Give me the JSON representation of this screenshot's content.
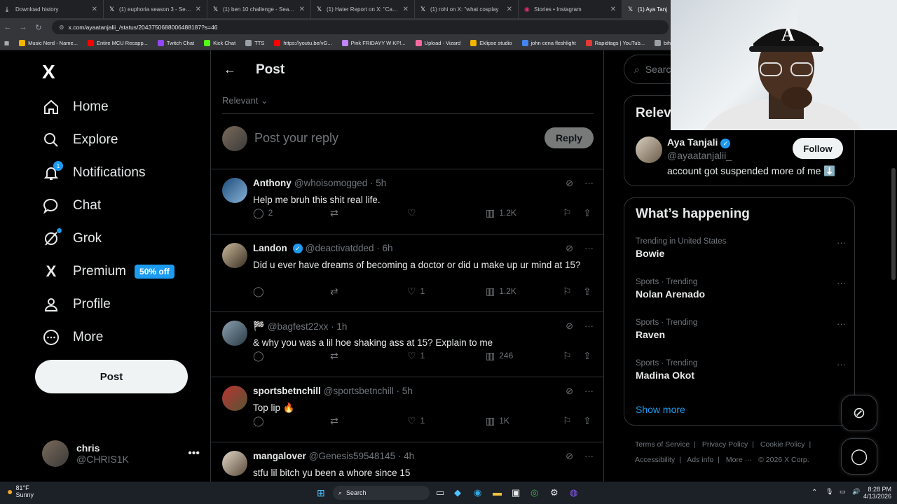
{
  "browser": {
    "tabs": [
      {
        "label": "Download history",
        "icon": "download-icon"
      },
      {
        "label": "(1) euphoria season 3 - Search",
        "icon": "x-logo-icon"
      },
      {
        "label": "(1) ben 10 challenge - Search /",
        "icon": "x-logo-icon"
      },
      {
        "label": "(1) Hater Report on X: \"Camero",
        "icon": "x-logo-icon"
      },
      {
        "label": "(1) rohi on X: \"what cosplay",
        "icon": "x-logo-icon"
      },
      {
        "label": "Stories • Instagram",
        "icon": "instagram-icon"
      },
      {
        "label": "(1) Aya Tanj",
        "icon": "x-logo-icon"
      }
    ],
    "url": "x.com/ayaatanjalii_/status/2043750688006488187?s=46",
    "bookmarks": [
      {
        "label": "Music Nerd - Name...",
        "color": "#f4b400"
      },
      {
        "label": "Entire MCU Recapp...",
        "color": "#ff0000"
      },
      {
        "label": "Twitch Chat",
        "color": "#9146ff"
      },
      {
        "label": "Kick Chat",
        "color": "#53fc18"
      },
      {
        "label": "TTS",
        "color": "#9aa0a6"
      },
      {
        "label": "https://youtu.be/vG...",
        "color": "#ff0000"
      },
      {
        "label": "Pink FRIDAYY W KP!...",
        "color": "#c084fc"
      },
      {
        "label": "Upload - Vizard",
        "color": "#ff6aa0"
      },
      {
        "label": "Eklipse studio",
        "color": "#f4b400"
      },
      {
        "label": "john cena fleshlight",
        "color": "#4285f4"
      },
      {
        "label": "Rapidtags | YouTub...",
        "color": "#e53935"
      },
      {
        "label": "bih links",
        "color": "#9aa0a6"
      }
    ]
  },
  "sidebar": {
    "logo": "X",
    "items": [
      {
        "label": "Home",
        "icon": "home-icon"
      },
      {
        "label": "Explore",
        "icon": "search-icon"
      },
      {
        "label": "Notifications",
        "icon": "bell-icon",
        "badge": "1"
      },
      {
        "label": "Chat",
        "icon": "chat-icon"
      },
      {
        "label": "Grok",
        "icon": "grok-icon"
      },
      {
        "label": "Premium",
        "icon": "x-logo-icon",
        "offer": "50% off"
      },
      {
        "label": "Profile",
        "icon": "person-icon"
      },
      {
        "label": "More",
        "icon": "more-circle-icon"
      }
    ],
    "post_label": "Post",
    "account": {
      "name": "chris",
      "handle": "@CHRIS1K"
    }
  },
  "main": {
    "title": "Post",
    "sort": "Relevant",
    "reply_placeholder": "Post your reply",
    "reply_button": "Reply",
    "replies": [
      {
        "name": "Anthony",
        "verified": false,
        "handle": "@whoisomogged",
        "time": "5h",
        "text": "Help me bruh this shit real life.",
        "comments": "2",
        "reposts": "",
        "likes": "",
        "views": "1.2K"
      },
      {
        "name": "Landon",
        "verified": true,
        "handle": "@deactivatdded",
        "time": "6h",
        "text": "Did u ever have dreams of becoming a doctor or did u make up ur mind at 15?",
        "comments": "",
        "reposts": "",
        "likes": "1",
        "views": "1.2K"
      },
      {
        "name": "🏁",
        "verified": false,
        "handle": "@bagfest22xx",
        "time": "1h",
        "text": "& why you was a lil hoe shaking ass at 15? Explain to me",
        "comments": "",
        "reposts": "",
        "likes": "1",
        "views": "246"
      },
      {
        "name": "sportsbetnchill",
        "verified": false,
        "handle": "@sportsbetnchill",
        "time": "5h",
        "text": "Top lip 🔥",
        "comments": "",
        "reposts": "",
        "likes": "1",
        "views": "1K"
      },
      {
        "name": "mangalover",
        "verified": false,
        "handle": "@Genesis59548145",
        "time": "4h",
        "text": "stfu lil bitch yu been a whore since 15",
        "comments": "",
        "reposts": "",
        "likes": "",
        "views": ""
      }
    ]
  },
  "right": {
    "search_placeholder": "Searc",
    "relevant_title": "Relev",
    "relevant_person": {
      "name": "Aya Tanjali",
      "handle": "@ayaatanjalii_",
      "bio": "account got suspended more of me ⬇️",
      "follow": "Follow"
    },
    "happening_title": "What’s happening",
    "trends": [
      {
        "category": "Trending in United States",
        "title": "Bowie"
      },
      {
        "category": "Sports · Trending",
        "title": "Nolan Arenado"
      },
      {
        "category": "Sports · Trending",
        "title": "Raven"
      },
      {
        "category": "Sports · Trending",
        "title": "Madina Okot"
      }
    ],
    "show_more": "Show more",
    "footer": [
      "Terms of Service",
      "Privacy Policy",
      "Cookie Policy",
      "Accessibility",
      "Ads info",
      "More ···",
      "© 2026 X Corp."
    ]
  },
  "taskbar": {
    "weather_temp": "81°F",
    "weather_desc": "Sunny",
    "search": "Search",
    "time": "8:28 PM",
    "date": "4/13/2026"
  }
}
